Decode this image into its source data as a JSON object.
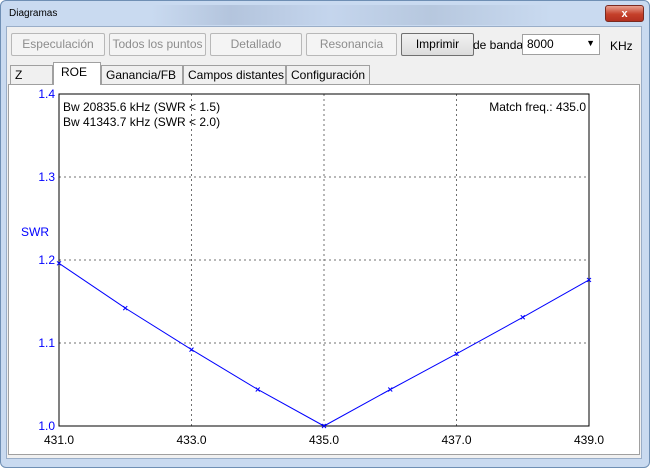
{
  "window": {
    "title": "Diagramas",
    "close": "x"
  },
  "toolbar": {
    "buttons": [
      {
        "label": "Especulación",
        "enabled": false
      },
      {
        "label": "Todos los puntos",
        "enabled": false
      },
      {
        "label": "Detallado",
        "enabled": false
      },
      {
        "label": "Resonancia",
        "enabled": false
      },
      {
        "label": "Imprimir",
        "enabled": true
      }
    ],
    "bandwidth_label": "de banda",
    "bandwidth_value": "8000",
    "unit": "KHz"
  },
  "tabs": [
    {
      "label": "Z",
      "selected": false
    },
    {
      "label": "ROE",
      "selected": true
    },
    {
      "label": "Ganancia/FB",
      "selected": false
    },
    {
      "label": "Campos distantes",
      "selected": false
    },
    {
      "label": "Configuración",
      "selected": false
    }
  ],
  "chart_data": {
    "type": "line",
    "ylabel": "SWR",
    "xlim": [
      431.0,
      439.0
    ],
    "ylim": [
      1.0,
      1.4
    ],
    "xticks": [
      "431.0",
      "433.0",
      "435.0",
      "437.0",
      "439.0"
    ],
    "yticks": [
      "1.0",
      "1.1",
      "1.2",
      "1.3",
      "1.4"
    ],
    "grid": true,
    "annotations": {
      "bw1": "Bw 20835.6 kHz (SWR < 1.5)",
      "bw2": "Bw 41343.7 kHz (SWR < 2.0)",
      "match": "Match freq.: 435.0"
    },
    "series": [
      {
        "color": "#0000ff",
        "x": [
          431.0,
          432.0,
          433.0,
          434.0,
          435.0,
          436.0,
          437.0,
          438.0,
          439.0
        ],
        "y": [
          1.196,
          1.142,
          1.092,
          1.044,
          1.0,
          1.044,
          1.087,
          1.131,
          1.176
        ]
      }
    ]
  }
}
